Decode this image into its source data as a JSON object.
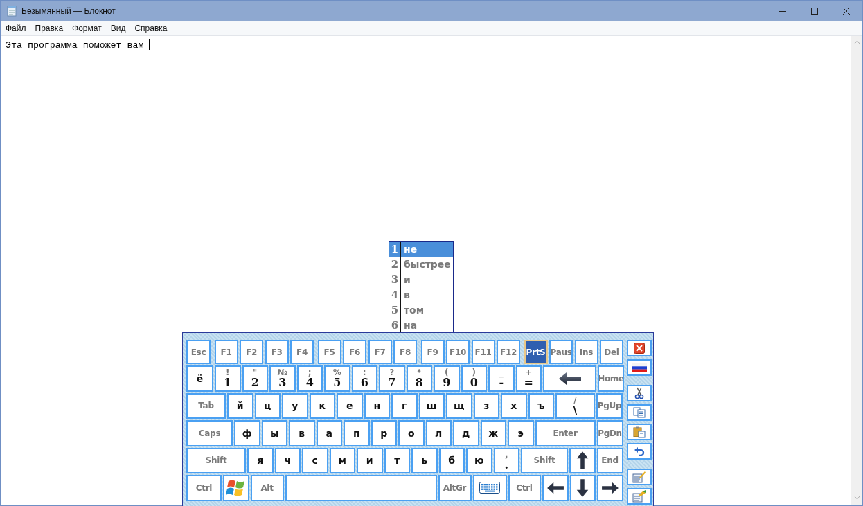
{
  "window": {
    "title": "Безымянный — Блокнот"
  },
  "menu": [
    "Файл",
    "Правка",
    "Формат",
    "Вид",
    "Справка"
  ],
  "editor": {
    "text": "Эта программа поможет вам "
  },
  "suggestions": [
    {
      "number": "1",
      "word": "не",
      "selected": true
    },
    {
      "number": "2",
      "word": "быстрее",
      "selected": false
    },
    {
      "number": "3",
      "word": "и",
      "selected": false
    },
    {
      "number": "4",
      "word": "в",
      "selected": false
    },
    {
      "number": "5",
      "word": "том",
      "selected": false
    },
    {
      "number": "6",
      "word": "на",
      "selected": false
    }
  ],
  "keyboard": {
    "rows": [
      {
        "groups": [
          [
            {
              "kind": "fn",
              "label": "Esc",
              "active": false
            }
          ],
          [
            {
              "kind": "fn",
              "label": "F1",
              "active": false
            },
            {
              "kind": "fn",
              "label": "F2",
              "active": false
            },
            {
              "kind": "fn",
              "label": "F3",
              "active": false
            },
            {
              "kind": "fn",
              "label": "F4",
              "active": false
            }
          ],
          [
            {
              "kind": "fn",
              "label": "F5",
              "active": false
            },
            {
              "kind": "fn",
              "label": "F6",
              "active": false
            },
            {
              "kind": "fn",
              "label": "F7",
              "active": false
            },
            {
              "kind": "fn",
              "label": "F8",
              "active": false
            }
          ],
          [
            {
              "kind": "fn",
              "label": "F9",
              "active": false
            },
            {
              "kind": "fn",
              "label": "F10",
              "active": false
            },
            {
              "kind": "fn",
              "label": "F11",
              "active": false
            },
            {
              "kind": "fn",
              "label": "F12",
              "active": false
            }
          ],
          [
            {
              "kind": "fn",
              "label": "PrtS",
              "active": true
            },
            {
              "kind": "fn",
              "label": "Paus",
              "active": false
            },
            {
              "kind": "fn",
              "label": "Ins",
              "active": false
            },
            {
              "kind": "fn",
              "label": "Del",
              "active": false
            }
          ]
        ]
      },
      {
        "groups": [
          [
            {
              "kind": "char",
              "label": "ё",
              "active": false
            },
            {
              "kind": "dual",
              "upper": "!",
              "lower": "1",
              "active": false
            },
            {
              "kind": "dual",
              "upper": "\"",
              "lower": "2",
              "active": false
            },
            {
              "kind": "dual",
              "upper": "№",
              "lower": "3",
              "active": false
            },
            {
              "kind": "dual",
              "upper": ";",
              "lower": "4",
              "active": false
            },
            {
              "kind": "dual",
              "upper": "%",
              "lower": "5",
              "active": false
            },
            {
              "kind": "dual",
              "upper": ":",
              "lower": "6",
              "active": false
            },
            {
              "kind": "dual",
              "upper": "?",
              "lower": "7",
              "active": false
            },
            {
              "kind": "dual",
              "upper": "*",
              "lower": "8",
              "active": false
            },
            {
              "kind": "dual",
              "upper": "(",
              "lower": "9",
              "active": false
            },
            {
              "kind": "dual",
              "upper": ")",
              "lower": "0",
              "active": false
            },
            {
              "kind": "dual",
              "upper": "_",
              "lower": "-",
              "active": false
            },
            {
              "kind": "dual",
              "upper": "+",
              "lower": "=",
              "active": false
            },
            {
              "kind": "backspace",
              "active": false
            },
            {
              "kind": "fn",
              "label": "Home",
              "active": false
            }
          ]
        ]
      },
      {
        "groups": [
          [
            {
              "kind": "fn",
              "label": "Tab",
              "active": false
            },
            {
              "kind": "char",
              "label": "й",
              "active": false
            },
            {
              "kind": "char",
              "label": "ц",
              "active": false
            },
            {
              "kind": "char",
              "label": "у",
              "active": false
            },
            {
              "kind": "char",
              "label": "к",
              "active": false
            },
            {
              "kind": "char",
              "label": "е",
              "active": false
            },
            {
              "kind": "char",
              "label": "н",
              "active": false
            },
            {
              "kind": "char",
              "label": "г",
              "active": false
            },
            {
              "kind": "char",
              "label": "ш",
              "active": false
            },
            {
              "kind": "char",
              "label": "щ",
              "active": false
            },
            {
              "kind": "char",
              "label": "з",
              "active": false
            },
            {
              "kind": "char",
              "label": "х",
              "active": false
            },
            {
              "kind": "char",
              "label": "ъ",
              "active": false
            },
            {
              "kind": "dual",
              "upper": "/",
              "lower": "\\",
              "active": false
            },
            {
              "kind": "fn",
              "label": "PgUp",
              "active": false
            }
          ]
        ]
      },
      {
        "groups": [
          [
            {
              "kind": "fn",
              "label": "Caps",
              "active": false
            },
            {
              "kind": "char",
              "label": "ф",
              "active": false
            },
            {
              "kind": "char",
              "label": "ы",
              "active": false
            },
            {
              "kind": "char",
              "label": "в",
              "active": false
            },
            {
              "kind": "char",
              "label": "а",
              "active": false
            },
            {
              "kind": "char",
              "label": "п",
              "active": false
            },
            {
              "kind": "char",
              "label": "р",
              "active": false
            },
            {
              "kind": "char",
              "label": "о",
              "active": false
            },
            {
              "kind": "char",
              "label": "л",
              "active": false
            },
            {
              "kind": "char",
              "label": "д",
              "active": false
            },
            {
              "kind": "char",
              "label": "ж",
              "active": false
            },
            {
              "kind": "char",
              "label": "э",
              "active": false
            },
            {
              "kind": "fn",
              "label": "Enter",
              "active": false
            },
            {
              "kind": "fn",
              "label": "PgDn",
              "active": false
            }
          ]
        ]
      },
      {
        "groups": [
          [
            {
              "kind": "fn",
              "label": "Shift",
              "active": false
            },
            {
              "kind": "char",
              "label": "я",
              "active": false
            },
            {
              "kind": "char",
              "label": "ч",
              "active": false
            },
            {
              "kind": "char",
              "label": "с",
              "active": false
            },
            {
              "kind": "char",
              "label": "м",
              "active": false
            },
            {
              "kind": "char",
              "label": "и",
              "active": false
            },
            {
              "kind": "char",
              "label": "т",
              "active": false
            },
            {
              "kind": "char",
              "label": "ь",
              "active": false
            },
            {
              "kind": "char",
              "label": "б",
              "active": false
            },
            {
              "kind": "char",
              "label": "ю",
              "active": false
            },
            {
              "kind": "dual",
              "upper": ",",
              "lower": ".",
              "active": false
            },
            {
              "kind": "fn",
              "label": "Shift",
              "active": false
            },
            {
              "kind": "up",
              "active": false
            },
            {
              "kind": "fn",
              "label": "End",
              "active": false
            }
          ]
        ]
      },
      {
        "groups": [
          [
            {
              "kind": "fn",
              "label": "Ctrl",
              "active": false
            },
            {
              "kind": "windows",
              "active": false
            },
            {
              "kind": "fn",
              "label": "Alt",
              "active": false
            },
            {
              "kind": "space",
              "active": false
            },
            {
              "kind": "fn",
              "label": "AltGr",
              "active": false
            },
            {
              "kind": "keyboard",
              "active": false
            },
            {
              "kind": "fn",
              "label": "Ctrl",
              "active": false
            },
            {
              "kind": "left",
              "active": false
            },
            {
              "kind": "down",
              "active": false
            },
            {
              "kind": "right",
              "active": false
            }
          ]
        ]
      }
    ]
  }
}
